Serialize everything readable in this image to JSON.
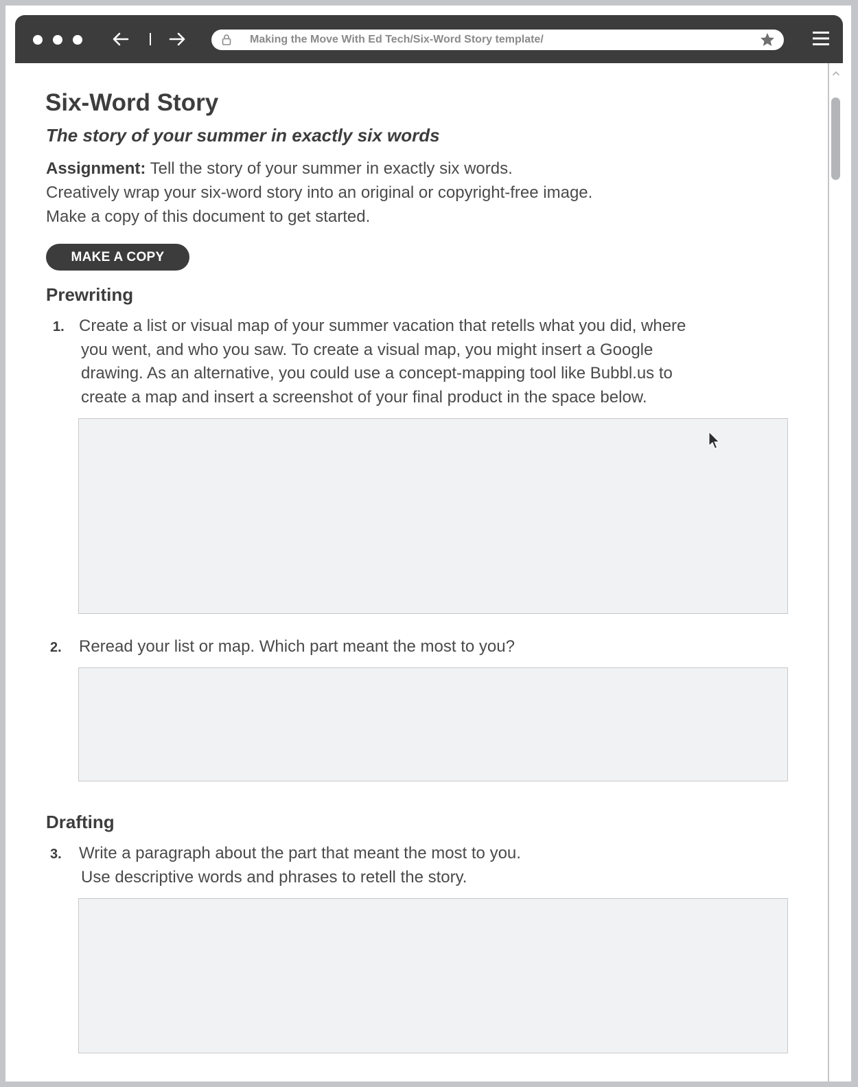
{
  "browser": {
    "url": "Making the Move With Ed Tech/Six-Word Story template/",
    "icons": {
      "back": "arrow-left-icon",
      "forward": "arrow-right-icon",
      "lock": "lock-icon",
      "bookmark": "star-icon",
      "menu": "hamburger-menu-icon"
    }
  },
  "page": {
    "title": "Six-Word Story",
    "subtitle": "The story of your summer in exactly six words",
    "assignment": {
      "label": "Assignment:",
      "lines": [
        "Tell the story of your summer in exactly six words.",
        "Creatively wrap your six-word story into an original or copyright-free image.",
        "Make a copy of this document to get started."
      ]
    },
    "make_copy_label": "MAKE A COPY"
  },
  "sections": [
    {
      "heading": "Prewriting",
      "items": [
        {
          "number": "1.",
          "lines": [
            "Create a list or visual map of your summer vacation that retells what you did, where",
            "you went, and who you saw. To create a visual map, you might insert a Google",
            "drawing. As an alternative, you could use a concept-mapping tool like Bubbl.us to",
            "create a map and insert a screenshot of your final product in the space below."
          ]
        },
        {
          "number": "2.",
          "lines": [
            "Reread your list or map. Which part meant the most to you?"
          ]
        }
      ]
    },
    {
      "heading": "Drafting",
      "items": [
        {
          "number": "3.",
          "lines": [
            "Write a paragraph about the part that meant the most to you.",
            "Use descriptive words and phrases to retell the story."
          ]
        }
      ]
    }
  ],
  "colors": {
    "chrome": "#3c3c3c",
    "answer_box": "#f1f2f4",
    "text": "#3d3d3d",
    "frame": "#c4c5c9"
  }
}
